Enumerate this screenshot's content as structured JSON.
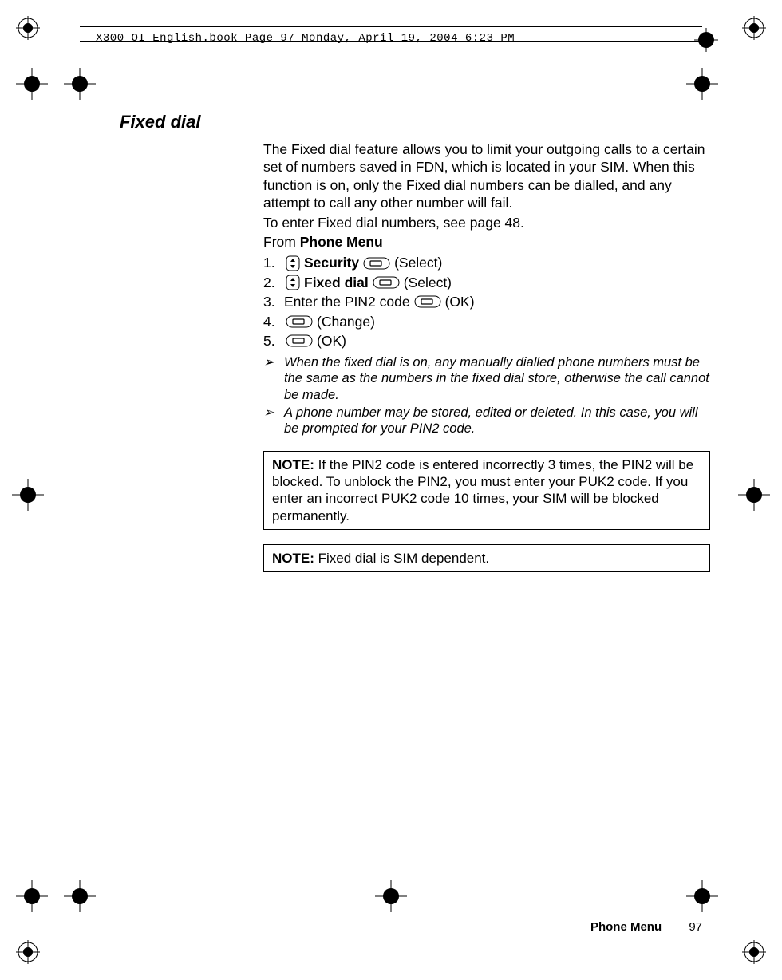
{
  "header": {
    "text": "X300_OI_English.book  Page 97  Monday, April 19, 2004  6:23 PM"
  },
  "section": {
    "title": "Fixed dial",
    "paragraph": "The Fixed dial feature allows you to limit your outgoing calls to a certain set of numbers saved in FDN, which is located in your SIM. When this function is on, only the Fixed dial numbers can be dialled, and any attempt to call any other number will fail.",
    "paragraph2": "To enter Fixed dial numbers, see page 48.",
    "from_prefix": "From ",
    "from_bold": "Phone Menu",
    "steps": [
      {
        "num": "1.",
        "nav": true,
        "bold": "Security",
        "softkey": true,
        "suffix": "(Select)"
      },
      {
        "num": "2.",
        "nav": true,
        "bold": "Fixed dial",
        "softkey": true,
        "suffix": "(Select)"
      },
      {
        "num": "3.",
        "nav": false,
        "plain": "Enter the PIN2 code",
        "softkey": true,
        "suffix": "(OK)"
      },
      {
        "num": "4.",
        "nav": false,
        "softkey": true,
        "suffix": "(Change)"
      },
      {
        "num": "5.",
        "nav": false,
        "softkey": true,
        "suffix": "(OK)"
      }
    ],
    "bullets": [
      "When the fixed dial is on, any manually dialled phone numbers must be the same as the numbers in the fixed dial store, otherwise the call cannot be made.",
      "A phone number may be stored, edited or deleted. In this case, you will be prompted for your PIN2 code."
    ],
    "note1_label": "NOTE:",
    "note1": " If the PIN2 code is entered incorrectly 3 times, the PIN2 will be blocked. To unblock the PIN2, you must enter your PUK2 code. If you enter an incorrect PUK2 code 10 times, your SIM will be blocked permanently.",
    "note2_label": "NOTE:",
    "note2": " Fixed dial is SIM dependent."
  },
  "footer": {
    "label": "Phone Menu",
    "page": "97"
  }
}
